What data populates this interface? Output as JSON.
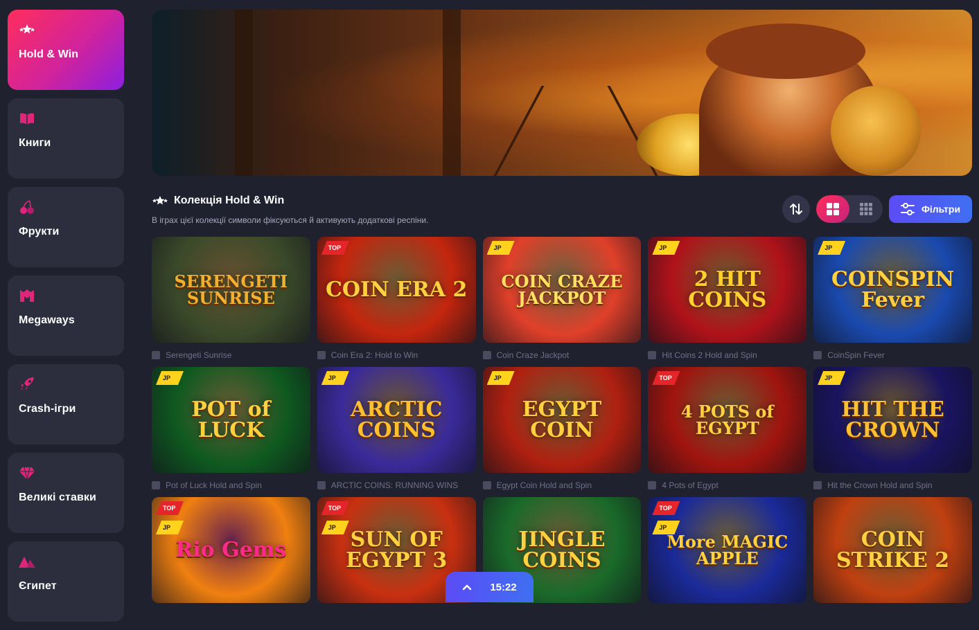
{
  "sidebar": {
    "items": [
      {
        "label": "Hold & Win",
        "icon": "stars-icon"
      },
      {
        "label": "Книги",
        "icon": "book-icon"
      },
      {
        "label": "Фрукти",
        "icon": "cherry-icon"
      },
      {
        "label": "Megaways",
        "icon": "megaways-icon"
      },
      {
        "label": "Crash-ігри",
        "icon": "rocket-icon"
      },
      {
        "label": "Великі ставки",
        "icon": "diamond-icon"
      },
      {
        "label": "Єгипет",
        "icon": "pyramid-icon"
      }
    ]
  },
  "section": {
    "title": "Колекція Hold & Win",
    "description": "В іграх цієї колекції символи фіксуються й активують додаткові респіни."
  },
  "controls": {
    "filter_label": "Фільтри"
  },
  "games": [
    {
      "name": "Serengeti Sunrise",
      "art": "SERENGETI SUNRISE",
      "tag": "",
      "bg": "#3a4a2a",
      "accent": "#f0b030"
    },
    {
      "name": "Coin Era 2: Hold to Win",
      "art": "COIN ERA 2",
      "tag": "TOP",
      "bg": "#c4260e",
      "accent": "#ffd040"
    },
    {
      "name": "Coin Craze Jackpot",
      "art": "COIN CRAZE JACKPOT",
      "tag": "JP",
      "bg": "#e0402a",
      "accent": "#ffe060"
    },
    {
      "name": "Hit Coins 2 Hold and Spin",
      "art": "2 HIT COINS",
      "tag": "JP",
      "bg": "#b0121a",
      "accent": "#ffd030"
    },
    {
      "name": "CoinSpin Fever",
      "art": "COINSPIN Fever",
      "tag": "JP",
      "bg": "#1a4ab0",
      "accent": "#ffd040"
    },
    {
      "name": "Pot of Luck Hold and Spin",
      "art": "POT of LUCK",
      "tag": "JP",
      "bg": "#0f5a20",
      "accent": "#ffd040"
    },
    {
      "name": "ARCTIC COINS: RUNNING WINS",
      "art": "ARCTIC COINS",
      "tag": "JP",
      "bg": "#3a2a9a",
      "accent": "#ffc030"
    },
    {
      "name": "Egypt Coin Hold and Spin",
      "art": "EGYPT COIN",
      "tag": "JP",
      "bg": "#b02010",
      "accent": "#ffd040"
    },
    {
      "name": "4 Pots of Egypt",
      "art": "4 POTS of EGYPT",
      "tag": "TOP",
      "bg": "#a0140e",
      "accent": "#ffd040"
    },
    {
      "name": "Hit the Crown Hold and Spin",
      "art": "HIT THE CROWN",
      "tag": "JP",
      "bg": "#1a1460",
      "accent": "#ffc030"
    },
    {
      "name": "",
      "art": "Rio Gems",
      "tag": "TOP JP",
      "bg": "#f08010",
      "accent": "#ff2a8a"
    },
    {
      "name": "",
      "art": "SUN OF EGYPT 3",
      "tag": "TOP JP",
      "bg": "#c83010",
      "accent": "#ffd040"
    },
    {
      "name": "",
      "art": "JINGLE COINS",
      "tag": "",
      "bg": "#1a6a2a",
      "accent": "#ffd040"
    },
    {
      "name": "",
      "art": "More MAGIC APPLE",
      "tag": "TOP JP",
      "bg": "#1a2a9a",
      "accent": "#ffd040"
    },
    {
      "name": "",
      "art": "COIN STRIKE 2",
      "tag": "",
      "bg": "#c04010",
      "accent": "#ffd040"
    }
  ],
  "timer": "15:22",
  "colors": {
    "accent_pink": "#ff2d5c",
    "accent_blue": "#4a5cf3",
    "background": "#20212f",
    "card": "#2c2d3d"
  }
}
